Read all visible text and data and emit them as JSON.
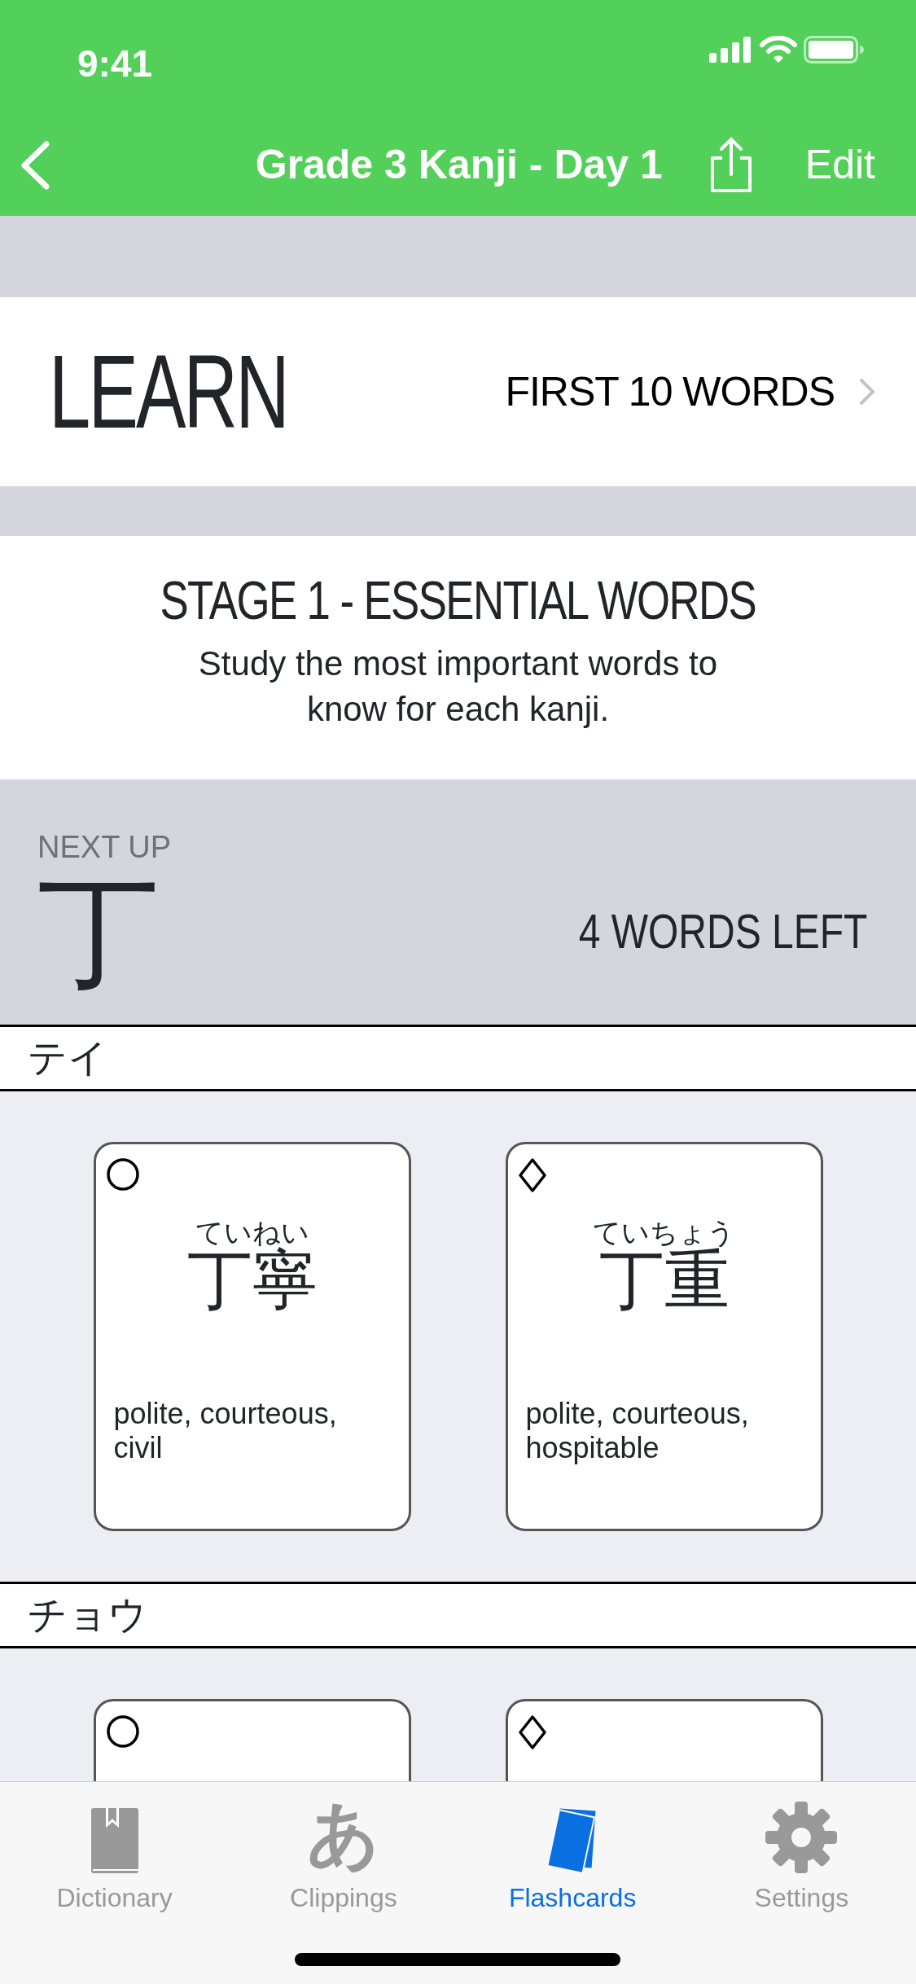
{
  "status_bar": {
    "time": "9:41"
  },
  "nav_bar": {
    "title": "Grade 3 Kanji - Day 1",
    "action": "Edit"
  },
  "learn": {
    "title": "LEARN",
    "link": "FIRST 10 WORDS"
  },
  "stage": {
    "title": "STAGE 1 - ESSENTIAL WORDS",
    "description": "Study the most important words to know for each kanji."
  },
  "next_up": {
    "label": "NEXT UP",
    "kanji": "丁",
    "count": "4 WORDS LEFT"
  },
  "groups": [
    {
      "reading": "テイ",
      "cards": [
        {
          "kind": "circle",
          "furigana": "ていねい",
          "word": "丁寧",
          "meaning": "polite, courteous, civil"
        },
        {
          "kind": "diamond",
          "furigana": "ていちょう",
          "word": "丁重",
          "meaning": "polite, courteous, hospitable"
        }
      ]
    },
    {
      "reading": "チョウ",
      "cards": [
        {
          "kind": "circle"
        },
        {
          "kind": "diamond"
        }
      ]
    }
  ],
  "tabs": [
    {
      "kind": "book",
      "label": "Dictionary",
      "selected": false
    },
    {
      "kind": "glyph",
      "glyph": "あ",
      "label": "Clippings",
      "selected": false
    },
    {
      "kind": "cards",
      "label": "Flashcards",
      "selected": true
    },
    {
      "kind": "gear",
      "label": "Settings",
      "selected": false
    }
  ]
}
